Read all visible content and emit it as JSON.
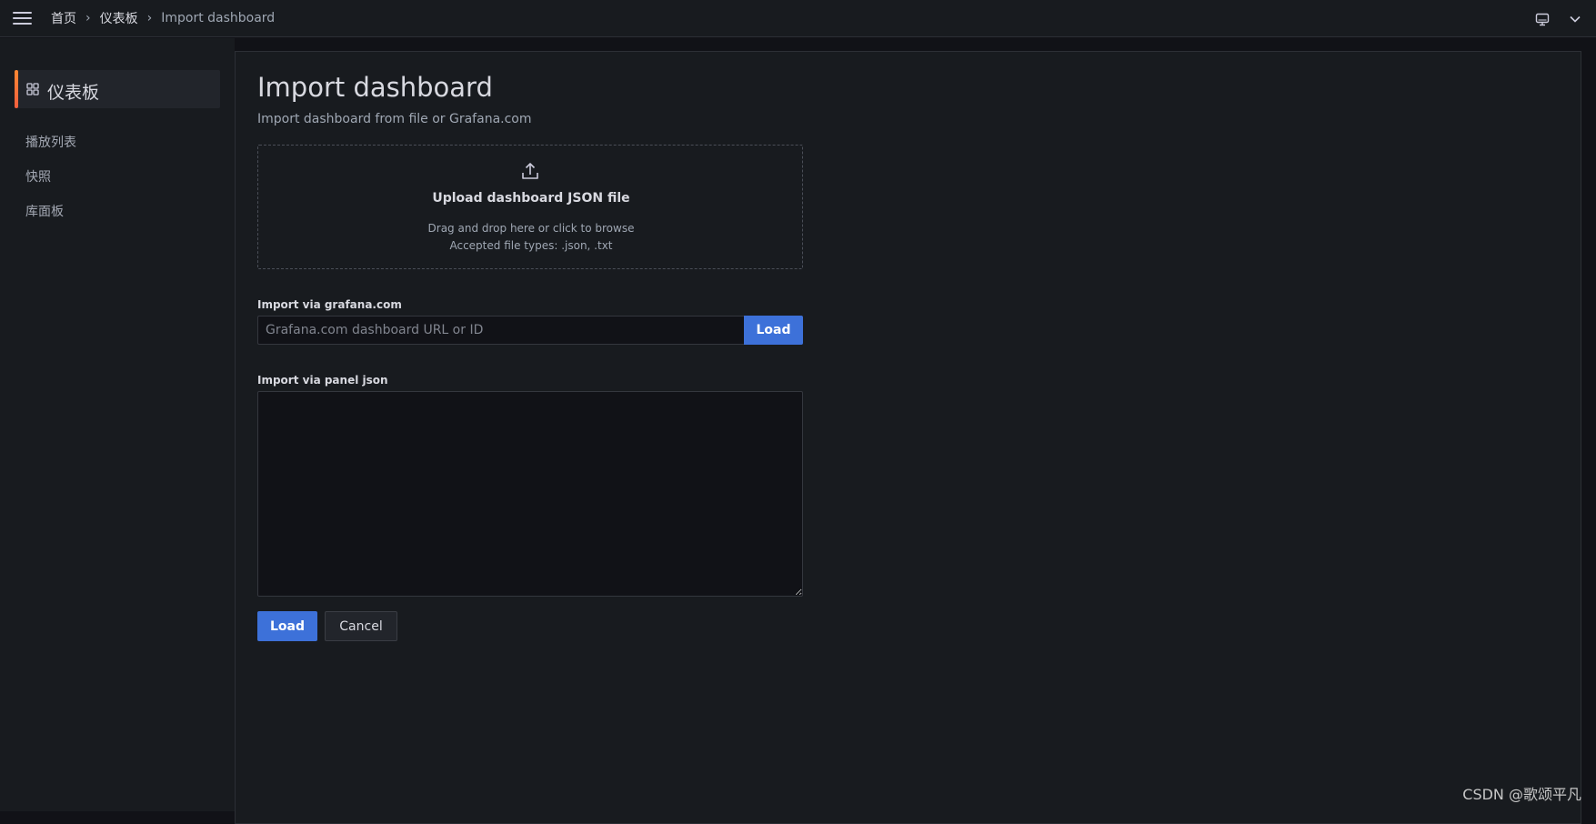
{
  "breadcrumb": {
    "items": [
      "首页",
      "仪表板",
      "Import dashboard"
    ],
    "separator": "›"
  },
  "topbar_icons": [
    "menu-icon",
    "tv-icon",
    "chevron-down-icon"
  ],
  "sidebar": {
    "active": {
      "label": "仪表板",
      "icon": "apps-grid-icon"
    },
    "items": [
      {
        "label": "播放列表"
      },
      {
        "label": "快照"
      },
      {
        "label": "库面板"
      }
    ]
  },
  "page": {
    "title": "Import dashboard",
    "subtitle": "Import dashboard from file or Grafana.com"
  },
  "upload": {
    "icon": "upload-icon",
    "title": "Upload dashboard JSON file",
    "hint": "Drag and drop here or click to browse",
    "accepted": "Accepted file types: .json, .txt"
  },
  "grafana_import": {
    "label": "Import via grafana.com",
    "placeholder": "Grafana.com dashboard URL or ID",
    "value": "",
    "button": "Load"
  },
  "json_import": {
    "label": "Import via panel json",
    "value": "",
    "load_button": "Load",
    "cancel_button": "Cancel"
  },
  "colors": {
    "primary": "#3d71d9",
    "accent": "#ff8833",
    "background": "#111217",
    "panel": "#181b1f"
  },
  "watermark": "CSDN @歌颂平凡"
}
